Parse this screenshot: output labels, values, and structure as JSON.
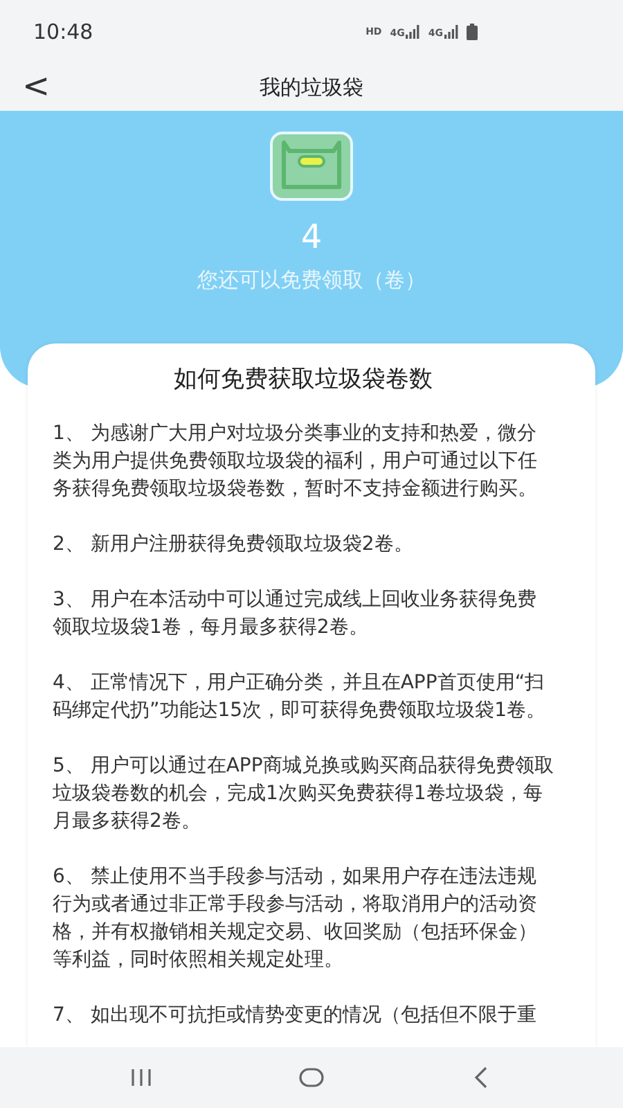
{
  "status_bar": {
    "time": "10:48",
    "network_label": "HD",
    "sim_labels": [
      "4G",
      "4G"
    ]
  },
  "header": {
    "back": "<",
    "title": "我的垃圾袋"
  },
  "summary": {
    "count": "4",
    "caption": "您还可以免费领取（卷）"
  },
  "rules": {
    "title": "如何免费获取垃圾袋卷数",
    "paragraphs": [
      "1、 为感谢广大用户对垃圾分类事业的支持和热爱，微分类为用户提供免费领取垃圾袋的福利，用户可通过以下任务获得免费领取垃圾袋卷数，暂时不支持金额进行购买。",
      "2、 新用户注册获得免费领取垃圾袋2卷。",
      "3、 用户在本活动中可以通过完成线上回收业务获得免费领取垃圾袋1卷，每月最多获得2卷。",
      "4、 正常情况下，用户正确分类，并且在APP首页使用“扫码绑定代扔”功能达15次，即可获得免费领取垃圾袋1卷。",
      "5、 用户可以通过在APP商城兑换或购买商品获得免费领取垃圾袋卷数的机会，完成1次购买免费获得1卷垃圾袋，每月最多获得2卷。",
      "6、 禁止使用不当手段参与活动，如果用户存在违法违规行为或者通过非正常手段参与活动，将取消用户的活动资格，并有权撤销相关规定交易、收回奖励（包括环保金）等利益，同时依照相关规定处理。",
      "7、 如出现不可抗拒或情势变更的情况（包括但不限于重"
    ]
  }
}
